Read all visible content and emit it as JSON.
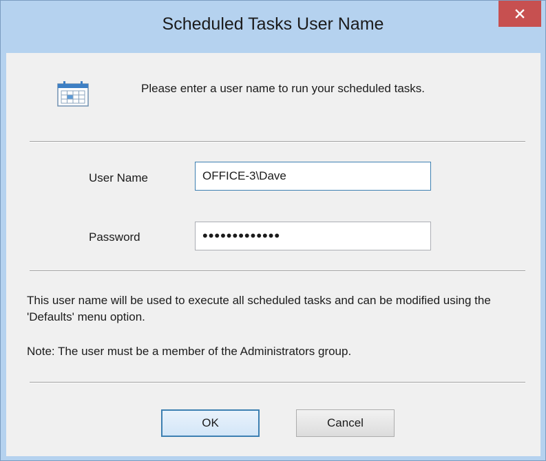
{
  "window": {
    "title": "Scheduled Tasks User Name",
    "close_symbol": "close-icon",
    "accent_color": "#c75050",
    "frame_color": "#b5d2ef"
  },
  "header": {
    "icon": "calendar-icon",
    "prompt": "Please enter a user name to run your scheduled tasks."
  },
  "form": {
    "user_name_label": "User Name",
    "user_name_value": "OFFICE-3\\Dave",
    "password_label": "Password",
    "password_value": "•••••••••••••"
  },
  "info": {
    "description": "This user name will be used to execute all scheduled tasks and can be modified using the 'Defaults' menu option.",
    "note": "Note: The user must be a member of the Administrators group."
  },
  "buttons": {
    "ok_label": "OK",
    "cancel_label": "Cancel"
  }
}
